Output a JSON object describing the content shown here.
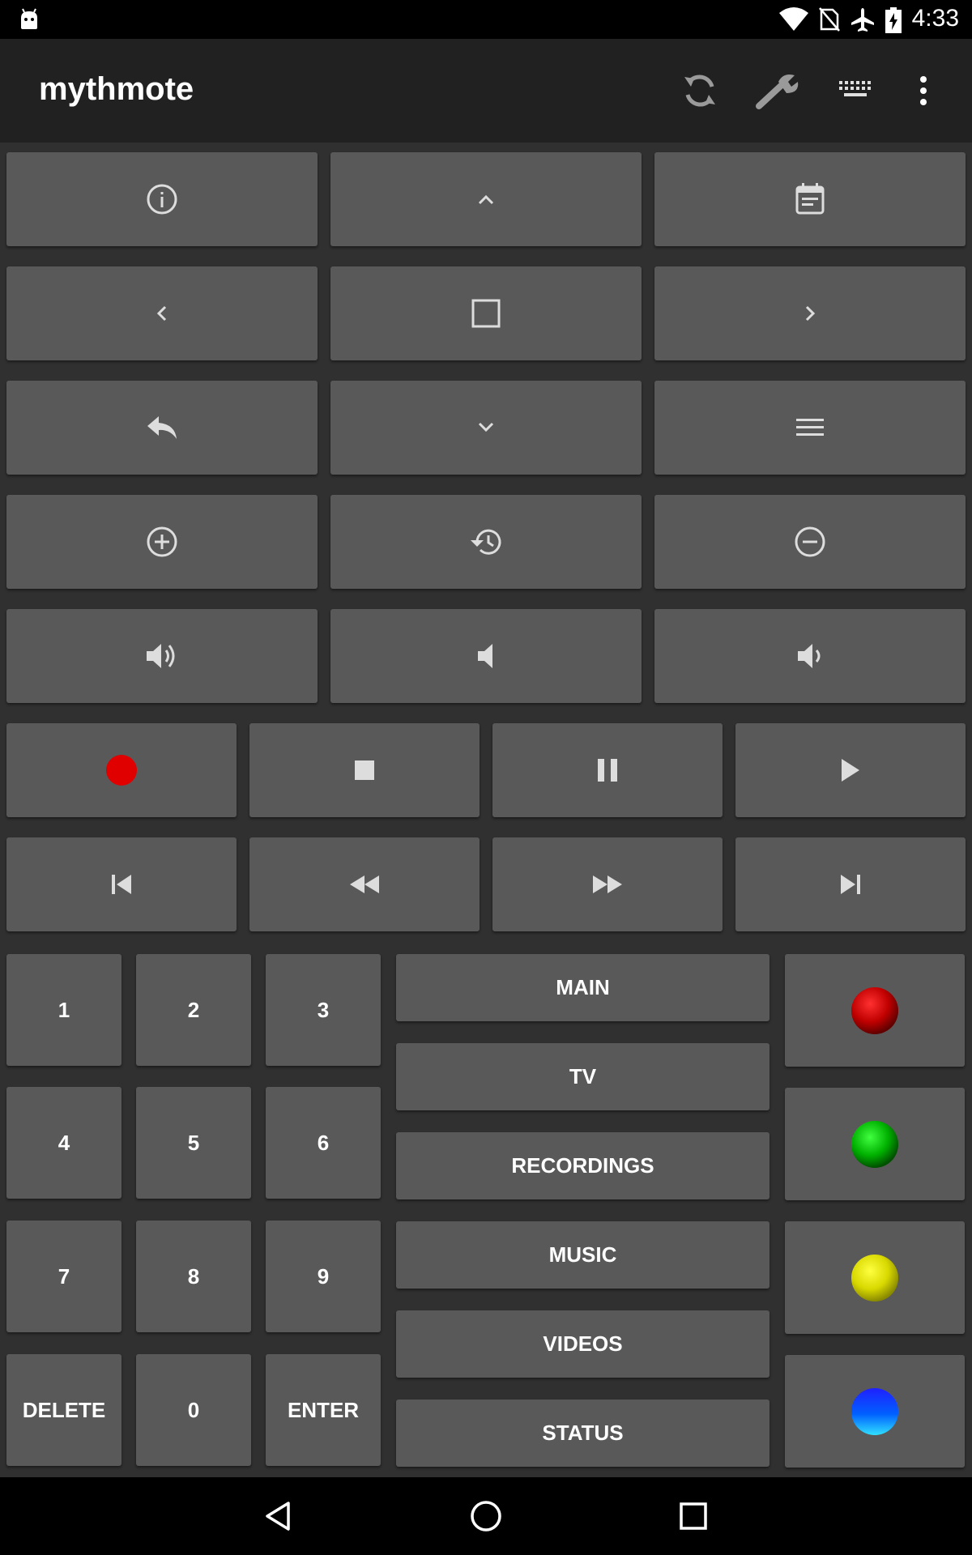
{
  "status_bar": {
    "time": "4:33"
  },
  "app_bar": {
    "title": "mythmote",
    "actions": [
      "refresh-icon",
      "wrench-icon",
      "keyboard-icon",
      "overflow-menu-icon"
    ]
  },
  "nav_buttons": [
    "info-icon",
    "up-icon",
    "guide-icon",
    "left-icon",
    "select-icon",
    "right-icon",
    "back-icon",
    "down-icon",
    "menu-icon",
    "channel-up-icon",
    "history-icon",
    "channel-down-icon",
    "volume-up-icon",
    "mute-icon",
    "volume-down-icon"
  ],
  "media_buttons": [
    "record-icon",
    "stop-icon",
    "pause-icon",
    "play-icon",
    "skip-back-icon",
    "rewind-icon",
    "fast-forward-icon",
    "skip-forward-icon"
  ],
  "keypad": [
    "1",
    "2",
    "3",
    "4",
    "5",
    "6",
    "7",
    "8",
    "9",
    "DELETE",
    "0",
    "ENTER"
  ],
  "jump_buttons": [
    "MAIN",
    "TV",
    "RECORDINGS",
    "MUSIC",
    "VIDEOS",
    "STATUS"
  ],
  "color_buttons": [
    {
      "name": "red",
      "color": "#e00000"
    },
    {
      "name": "green",
      "color": "#00c000"
    },
    {
      "name": "yellow",
      "color": "#e8e800"
    },
    {
      "name": "blue",
      "color": "#0040ff"
    }
  ]
}
